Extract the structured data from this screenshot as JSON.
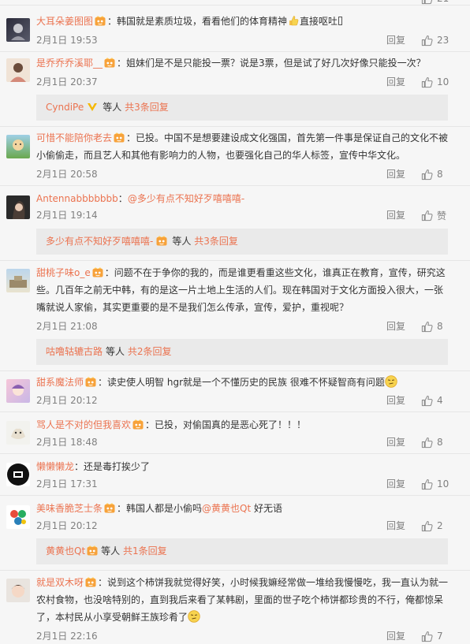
{
  "top_fragment": {
    "partial_count": "21"
  },
  "common": {
    "reply_label": "回复",
    "more_replies_suffix": "等人",
    "colon": "："
  },
  "comments": [
    {
      "user": "大耳朵姜图图",
      "text": "韩国就是素质垃圾，看看他们的体育精神",
      "text_after_emoji": "直接呕吐",
      "time": "2月1日 19:53",
      "likes": "23"
    },
    {
      "user": "是乔乔乔溪耶__",
      "text": "姐妹们是不是只能投一票？说是3票，但是试了好几次好像只能投一次？",
      "time": "2月1日 20:37",
      "likes": "10",
      "sub": {
        "user": "CyndiPe",
        "suffix": "等人",
        "link": "共3条回复"
      }
    },
    {
      "user": "可惜不能陪你老去",
      "text": "已投。中国不是想要建设成文化强国，首先第一件事是保证自己的文化不被小偷偷走，而且艺人和其他有影响力的人物，也要强化自己的华人标签，宣传中华文化。",
      "time": "2月1日 20:58",
      "likes": "8"
    },
    {
      "user": "Antennabbbbbbb",
      "mention": "@多少有点不知好歹嘻嘻嘻-",
      "time": "2月1日 19:14",
      "likes": "赞",
      "sub": {
        "user": "多少有点不知好歹嘻嘻嘻-",
        "suffix": "等人",
        "link": "共3条回复"
      }
    },
    {
      "user": "甜桃子味o_e",
      "text": "问题不在于争你的我的，而是谁更看重这些文化，谁真正在教育，宣传，研究这些。几百年之前无中韩，有的是这一片土地上生活的人们。现在韩国对于文化方面投入很大，一张嘴就说人家偷，其实更重要的是不是我们怎么传承，宣传，爱护，重视呢？",
      "time": "2月1日 21:08",
      "likes": "8",
      "sub": {
        "user": "咕噜轱辘古路",
        "suffix": "等人",
        "link": "共2条回复"
      }
    },
    {
      "user": "甜系魔法师",
      "text": "读史使人明智 hgr就是一个不懂历史的民族 很难不怀疑智商有问题",
      "time": "2月1日 20:12",
      "likes": "4"
    },
    {
      "user": "骂人是不对的但我喜欢",
      "text": "已投，对偷国真的是恶心死了！！！",
      "time": "2月1日 18:48",
      "likes": "8"
    },
    {
      "user": "懒懒懒龙",
      "text": "还是毒打挨少了",
      "time": "2月1日 17:31",
      "likes": "10"
    },
    {
      "user": "美味香脆芝士条",
      "text": "韩国人都是小偷吗",
      "mention": "@黄黄也Qt",
      "text_after_mention": " 好无语",
      "time": "2月1日 20:12",
      "likes": "2",
      "sub": {
        "user": "黄黄也Qt",
        "suffix": "等人",
        "link": "共1条回复"
      }
    },
    {
      "user": "就是双木呀",
      "text": "说到这个柿饼我就觉得好笑，小时候我嫲经常做一堆给我慢慢吃，我一直认为就一农村食物，也没啥特别的，直到我后来看了某韩剧，里面的世子吃个柿饼都珍贵的不行，俺都惊呆了，本村民从小享受朝鲜王族珍肴了",
      "time": "2月1日 22:16",
      "likes": "7"
    }
  ],
  "colors": {
    "accent": "#eb7350",
    "meta": "#808080",
    "subbox": "#eaeaea",
    "background": "#f6f6f6"
  },
  "icons": [
    "vip-badge-icon",
    "like-thumb-icon",
    "v-badge-icon",
    "smile-emoji-icon"
  ]
}
